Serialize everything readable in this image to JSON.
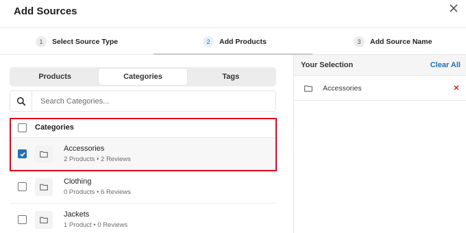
{
  "modal": {
    "title": "Add Sources"
  },
  "steps": [
    {
      "number": "1",
      "label": "Select Source Type"
    },
    {
      "number": "2",
      "label": "Add Products"
    },
    {
      "number": "3",
      "label": "Add Source Name"
    }
  ],
  "tabs": [
    "Products",
    "Categories",
    "Tags"
  ],
  "search": {
    "placeholder": "Search Categories..."
  },
  "list": {
    "header": "Categories",
    "items": [
      {
        "name": "Accessories",
        "meta": "2 Products • 2 Reviews",
        "checked": true
      },
      {
        "name": "Clothing",
        "meta": "0 Products • 6 Reviews",
        "checked": false
      },
      {
        "name": "Jackets",
        "meta": "1 Product • 0 Reviews",
        "checked": false
      }
    ]
  },
  "selection": {
    "title": "Your Selection",
    "clear_label": "Clear All",
    "items": [
      {
        "name": "Accessories"
      }
    ]
  },
  "colors": {
    "accent": "#2271b1",
    "highlight": "#e3001b",
    "remove": "#cc1818"
  },
  "icons": {
    "close": "close-icon",
    "search": "search-icon",
    "folder": "folder-icon",
    "remove": "remove-icon",
    "check": "checkmark-icon"
  }
}
